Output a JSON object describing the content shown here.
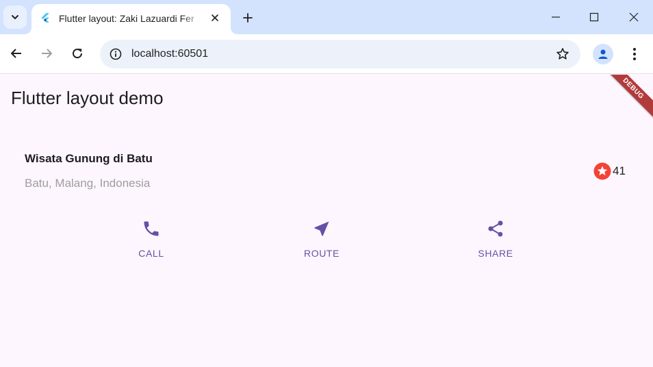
{
  "browser": {
    "tab": {
      "title": "Flutter layout: Zaki Lazuardi Fer",
      "favicon": "flutter-logo-icon"
    },
    "address_bar": {
      "url": "localhost:60501"
    }
  },
  "app": {
    "title": "Flutter layout demo",
    "debug_banner": "DEBUG",
    "location": {
      "name": "Wisata Gunung di Batu",
      "address": "Batu, Malang, Indonesia",
      "favorite_count": "41"
    },
    "actions": [
      {
        "label": "CALL",
        "icon": "phone-icon"
      },
      {
        "label": "ROUTE",
        "icon": "navigation-icon"
      },
      {
        "label": "SHARE",
        "icon": "share-icon"
      }
    ]
  },
  "colors": {
    "accent": "#6750a4",
    "star": "#f44336",
    "page_background": "#fdf6fe",
    "tabstrip": "#d3e3fd"
  }
}
